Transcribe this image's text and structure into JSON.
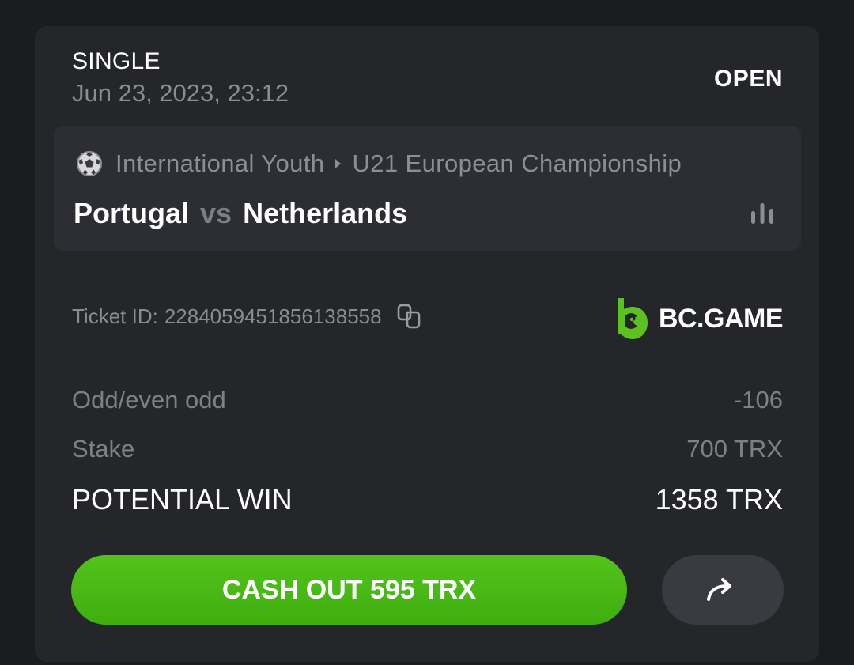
{
  "bet": {
    "type": "SINGLE",
    "date": "Jun 23, 2023, 23:12",
    "status": "OPEN"
  },
  "event": {
    "sport_icon": "soccer-ball-icon",
    "category": "International Youth",
    "league": "U21 European Championship",
    "home_team": "Portugal",
    "vs": "vs",
    "away_team": "Netherlands",
    "stats_icon": "bar-chart-icon"
  },
  "ticket": {
    "label": "Ticket ID:",
    "id": "228405945185613​8558",
    "copy_icon": "copy-icon"
  },
  "brand": {
    "name": "BC.GAME",
    "color": "#5cc21f"
  },
  "details": {
    "market_label": "Odd/even odd",
    "odds": "-106",
    "stake_label": "Stake",
    "stake_value": "700 TRX",
    "potential_win_label": "POTENTIAL WIN",
    "potential_win_value": "1358 TRX"
  },
  "actions": {
    "cashout_label": "CASH OUT 595 TRX",
    "share_icon": "share-arrow-icon"
  },
  "colors": {
    "background": "#1b1c1f",
    "card": "#25262a",
    "event_box": "#2d2e33",
    "accent_green": "#4cbb17",
    "muted_text": "#8b8c90"
  }
}
